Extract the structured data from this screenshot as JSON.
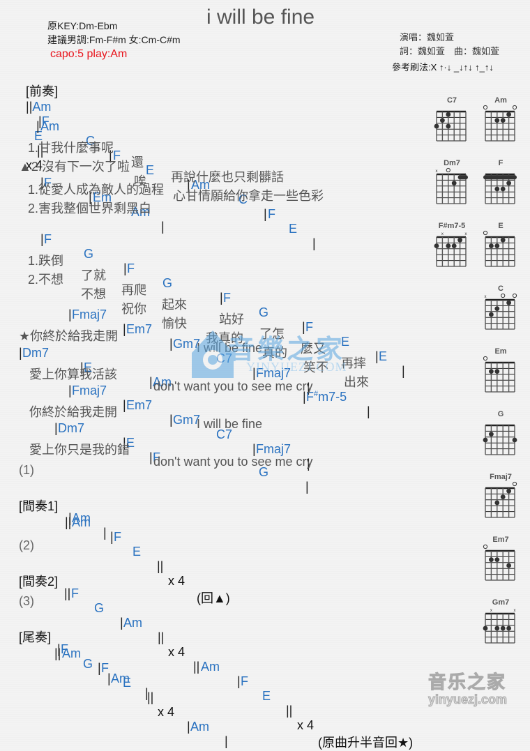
{
  "header": {
    "title": "i will be fine",
    "original_key": "原KEY:Dm-Ebm",
    "suggested_key": "建議男調:Fm-F#m 女:Cm-C#m",
    "capo": "capo:5 play:Am",
    "singer": "演唱：魏如萱",
    "writers": "詞：魏如萱　曲：魏如萱",
    "strum": "參考刷法:X ↑·↓ _↓↑↓ ↑_↑↓"
  },
  "sections": {
    "intro": {
      "label": "[前奏]",
      "open": "||",
      "c1": "Am",
      "c2": "F",
      "c3": "E",
      "close": "||",
      "repeat": "x 4"
    },
    "verse_chords1": [
      "Am",
      "C",
      "F",
      "E",
      "Am",
      "C",
      "F",
      "E"
    ],
    "verse_l1": [
      "1.甘我什麼事呢",
      "還",
      "再說什麼也只剩髒話"
    ],
    "verse_l2": [
      "▲2.沒有下一次了啦",
      "唉",
      "心甘情願給你拿走一些色彩"
    ],
    "verse_chords2": [
      "F",
      "Em",
      "Am"
    ],
    "verse_l3": "1.從愛人成為敵人的過程",
    "verse_l4": "2.害我整個世界剩黑白",
    "verse_chords3": [
      "F",
      "G",
      "F",
      "G",
      "F",
      "G",
      "F",
      "E",
      "E"
    ],
    "verse_l5": [
      "1.跌倒",
      "了就",
      "再爬",
      "起來",
      "站好",
      "了怎",
      "麼又",
      "再摔"
    ],
    "verse_l6": [
      "2.不想",
      "不想",
      "祝你",
      "愉快",
      "我真的",
      "真的",
      "笑不",
      "出來"
    ],
    "chorus_chords1": [
      "Fmaj7",
      "Em7",
      "Gm7",
      "C7",
      "Fmaj7"
    ],
    "chorus_l1": [
      "★你終於給我走開",
      "I will be fine"
    ],
    "chorus_chords2": [
      "Dm7",
      "E",
      "Am",
      "F",
      "#",
      "m7-5"
    ],
    "chorus_l2": [
      "愛上你算我活該",
      "don't want you to see me cry"
    ],
    "chorus_chords3": [
      "Fmaj7",
      "Em7",
      "Gm7",
      "C7",
      "Fmaj7"
    ],
    "chorus_l3": [
      "你終於給我走開",
      "I will be fine"
    ],
    "chorus_chords4": [
      "Dm7",
      "E",
      "F",
      "G"
    ],
    "chorus_l4": [
      "愛上你只是我的錯",
      "don't want you to see me cry"
    ],
    "s1": {
      "num": "(1)",
      "label": "[間奏1]",
      "c1": "Am",
      "l2c": [
        "Am",
        "F",
        "E"
      ],
      "repeat": "x 4",
      "note": "(回▲)"
    },
    "s2": {
      "num": "(2)",
      "label": "[間奏2]",
      "c": [
        "F",
        "G",
        "Am"
      ],
      "repeat1": "x 4",
      "c2": [
        "Am",
        "F",
        "E"
      ],
      "repeat2": "x 4",
      "note": "(原曲升半音回★)"
    },
    "s3": {
      "num": "(3)",
      "label": "[尾奏]",
      "c": [
        "F",
        "G",
        "Am"
      ],
      "c2": [
        "Am",
        "F",
        "E"
      ],
      "repeat": "x 4",
      "c3": "Am"
    }
  },
  "chords": [
    {
      "name": "C7"
    },
    {
      "name": "Am"
    },
    {
      "name": "Dm7"
    },
    {
      "name": "F"
    },
    {
      "name": "F#m7-5"
    },
    {
      "name": "E"
    },
    {
      "name": "C"
    },
    {
      "name": "Em"
    },
    {
      "name": "G"
    },
    {
      "name": "Fmaj7"
    },
    {
      "name": "Em7"
    },
    {
      "name": "Gm7"
    }
  ],
  "watermark": {
    "text1": "音樂之家",
    "text2": "YINYUEZJ.COM",
    "footer1": "音乐之家",
    "footer2": "yinyuezj.com"
  },
  "colors": {
    "chord": "#2a72c0",
    "capo": "#e8141c",
    "lyric": "#555555"
  }
}
